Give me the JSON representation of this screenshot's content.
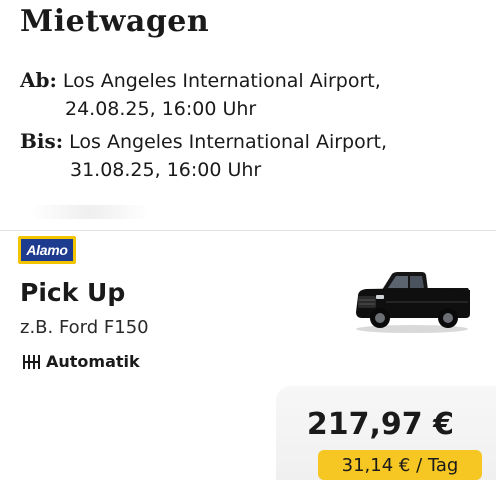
{
  "page": {
    "title": "Mietwagen"
  },
  "pickup": {
    "label": "Ab:",
    "location": "Los Angeles International Airport,",
    "datetime": "24.08.25, 16:00 Uhr"
  },
  "dropoff": {
    "label": "Bis:",
    "location": "Los Angeles International Airport,",
    "datetime": "31.08.25, 16:00 Uhr"
  },
  "offer": {
    "vendor": "Alamo",
    "car_class": "Pick Up",
    "car_example": "z.B. Ford F150",
    "transmission_icon": "gearshift-icon",
    "transmission": "Automatik",
    "price_total": "217,97 €",
    "price_per_day": "31,14 € / Tag",
    "colors": {
      "vendor_yellow": "#f2c400",
      "vendor_blue": "#1e3c8f",
      "price_highlight": "#f6c623"
    }
  }
}
